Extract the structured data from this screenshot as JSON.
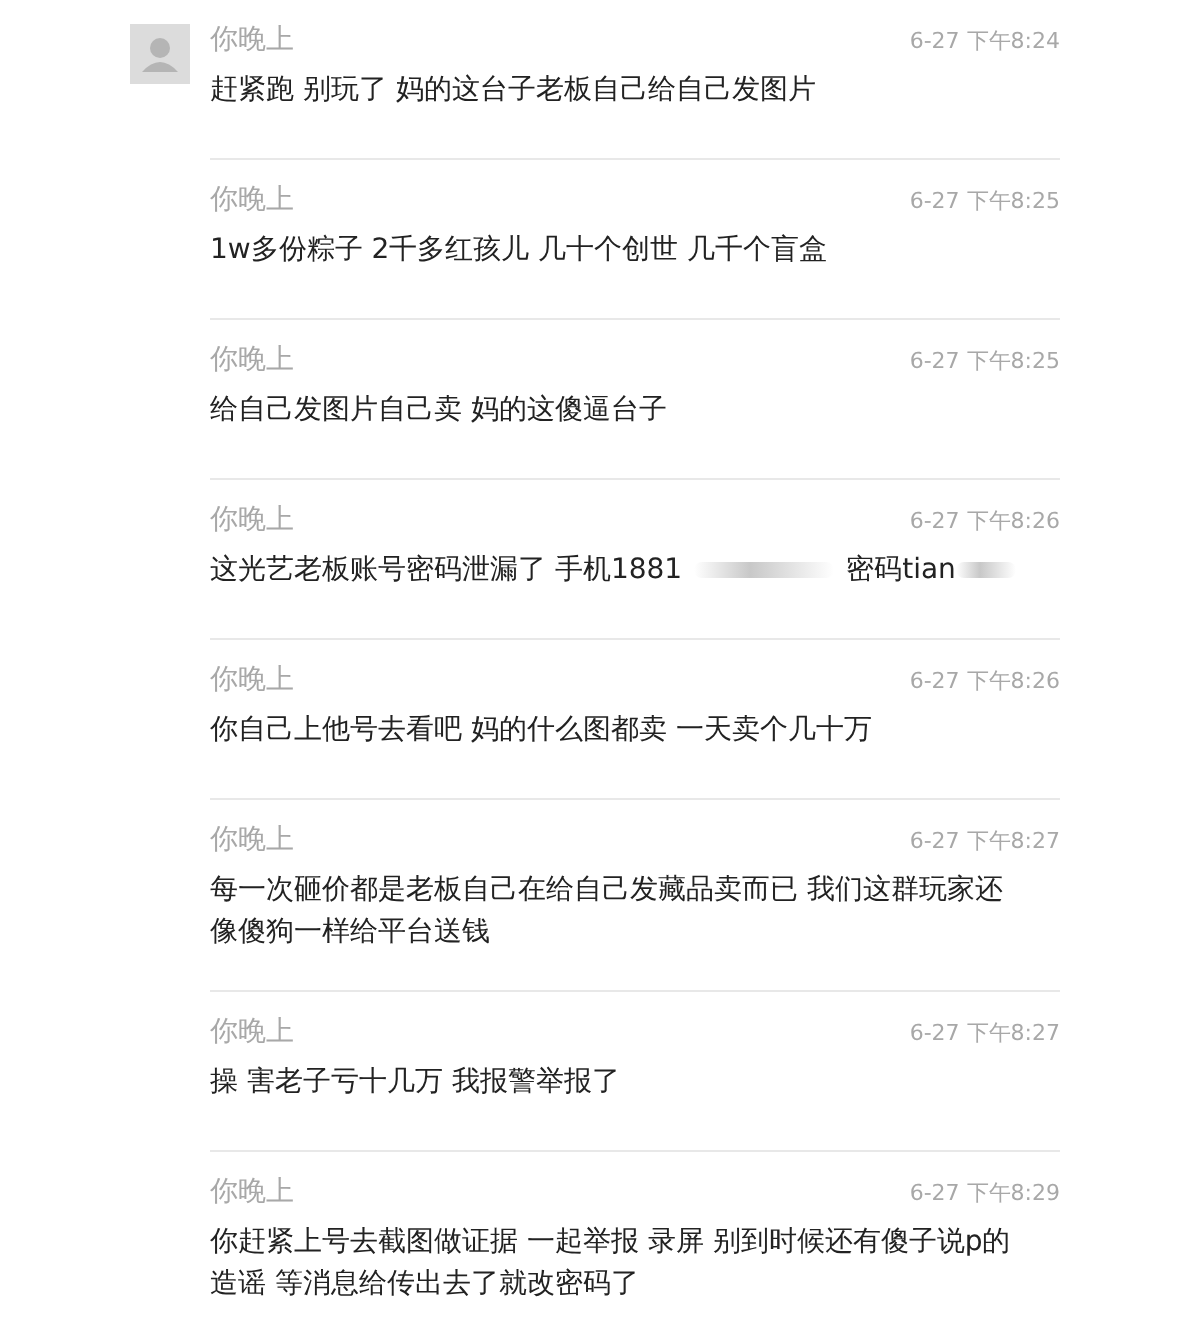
{
  "messages": [
    {
      "has_avatar": true,
      "name": "你晚上",
      "time": "6-27 下午8:24",
      "segments": [
        {
          "kind": "text",
          "text": "赶紧跑 别玩了 妈的这台子老板自己给自己发图片"
        }
      ]
    },
    {
      "has_avatar": false,
      "name": "你晚上",
      "time": "6-27 下午8:25",
      "segments": [
        {
          "kind": "text",
          "text": "1w多份粽子 2千多红孩儿 几十个创世 几千个盲盒"
        }
      ]
    },
    {
      "has_avatar": false,
      "name": "你晚上",
      "time": "6-27 下午8:25",
      "segments": [
        {
          "kind": "text",
          "text": "给自己发图片自己卖 妈的这傻逼台子"
        }
      ]
    },
    {
      "has_avatar": false,
      "name": "你晚上",
      "time": "6-27 下午8:26",
      "segments": [
        {
          "kind": "text",
          "text": "这光艺老板账号密码泄漏了 手机1881"
        },
        {
          "kind": "redacted"
        },
        {
          "kind": "text",
          "text": "密码tian"
        },
        {
          "kind": "redacted"
        }
      ]
    },
    {
      "has_avatar": false,
      "name": "你晚上",
      "time": "6-27 下午8:26",
      "segments": [
        {
          "kind": "text",
          "text": "你自己上他号去看吧 妈的什么图都卖 一天卖个几十万"
        }
      ]
    },
    {
      "has_avatar": false,
      "name": "你晚上",
      "time": "6-27 下午8:27",
      "segments": [
        {
          "kind": "text",
          "text": "每一次砸价都是老板自己在给自己发藏品卖而已 我们这群玩家还像傻狗一样给平台送钱"
        }
      ]
    },
    {
      "has_avatar": false,
      "name": "你晚上",
      "time": "6-27 下午8:27",
      "segments": [
        {
          "kind": "text",
          "text": "操 害老子亏十几万 我报警举报了"
        }
      ]
    },
    {
      "has_avatar": false,
      "name": "你晚上",
      "time": "6-27 下午8:29",
      "segments": [
        {
          "kind": "text",
          "text": "你赶紧上号去截图做证据 一起举报 录屏 别到时候还有傻子说p的造谣 等消息给传出去了就改密码了"
        }
      ]
    }
  ]
}
